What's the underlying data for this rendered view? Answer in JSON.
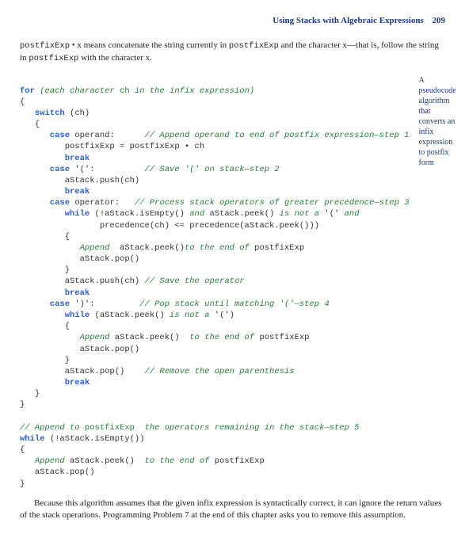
{
  "header": {
    "title": "Using Stacks with Algebraic Expressions",
    "pagenum": "209"
  },
  "intro": {
    "pre1": "postfixExp",
    "mid1": " • x means concatenate the string currently in ",
    "pre2": "postfixExp",
    "mid2": " and the character x—that is, follow the string in ",
    "pre3": "postfixExp",
    "mid3": " with the character x."
  },
  "sidenote": "A pseudocode algorithm that converts an infix expression to postfix form",
  "code": {
    "l01a": "for",
    "l01b": " (each character ",
    "l01c": "ch",
    "l01d": " in the infix expression)",
    "l02": "{",
    "l03a": "   switch",
    "l03b": " (ch)",
    "l04": "   {",
    "l05a": "      case",
    "l05b": " operand:      ",
    "l05c": "// Append operand to end of postfix expression—step 1",
    "l06": "         postfixExp = postfixExp • ch",
    "l07a": "         break",
    "l08a": "      case",
    "l08b": " '(':          ",
    "l08c": "// Save '(' on stack—step 2",
    "l09": "         aStack.push(ch)",
    "l10a": "         break",
    "l11a": "      case",
    "l11b": " operator:   ",
    "l11c": "// Process stack operators of greater precedence—step 3",
    "l12a": "         while",
    "l12b": " (!aStack.isEmpty() ",
    "l12c": "and",
    "l12d": " aStack.peek() ",
    "l12e": "is not a",
    "l12f": " '(' ",
    "l12g": "and",
    "l13": "                precedence(ch) <= precedence(aStack.peek()))",
    "l14": "         {",
    "l15a": "            Append ",
    "l15b": " aStack.peek()",
    "l15c": "to the end of",
    "l15d": " postfixExp",
    "l16": "            aStack.pop()",
    "l17": "         }",
    "l18a": "         aStack.push(ch) ",
    "l18b": "// Save the operator",
    "l19a": "         break",
    "l20a": "      case",
    "l20b": " ')':         ",
    "l20c": "// Pop stack until matching '('—step 4",
    "l21a": "         while",
    "l21b": " (aStack.peek() ",
    "l21c": "is not a",
    "l21d": " '(')",
    "l22": "         {",
    "l23a": "            Append",
    "l23b": " aStack.peek() ",
    "l23c": " to the end of",
    "l23d": " postfixExp",
    "l24": "            aStack.pop()",
    "l25": "         }",
    "l26a": "         aStack.pop()    ",
    "l26b": "// Remove the open parenthesis",
    "l27a": "         break",
    "l28": "   }",
    "l29": "}",
    "l30": "",
    "l31a": "// Append to ",
    "l31b": "postfixExp",
    "l31c": "  the operators remaining in the stack—step 5",
    "l32a": "while",
    "l32b": " (!aStack.isEmpty())",
    "l33": "{",
    "l34a": "   Append",
    "l34b": " aStack.peek() ",
    "l34c": " to the end of",
    "l34d": " postfixExp",
    "l35": "   aStack.pop()",
    "l36": "}"
  },
  "outro": "Because this algorithm assumes that the given infix expression is syntactically correct, it can ignore the return values of the stack operations. Programming Problem 7 at the end of this chapter asks you to remove this assumption."
}
